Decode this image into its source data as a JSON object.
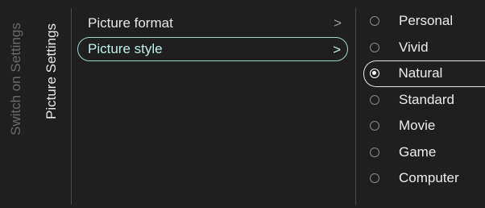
{
  "breadcrumbs": [
    "Switch on Settings",
    "Picture Settings"
  ],
  "menu": {
    "items": [
      {
        "label": "Picture format",
        "chevron": ">",
        "selected": false
      },
      {
        "label": "Picture style",
        "chevron": ">",
        "selected": true
      }
    ]
  },
  "options": {
    "items": [
      {
        "label": "Personal",
        "checked": false
      },
      {
        "label": "Vivid",
        "checked": false
      },
      {
        "label": "Natural",
        "checked": true
      },
      {
        "label": "Standard",
        "checked": false
      },
      {
        "label": "Movie",
        "checked": false
      },
      {
        "label": "Game",
        "checked": false
      },
      {
        "label": "Computer",
        "checked": false
      }
    ]
  },
  "colors": {
    "background": "#1f1f1f",
    "highlight": "#9fd6cf",
    "text": "#f2f2f2",
    "muted": "#6a6a6a"
  }
}
